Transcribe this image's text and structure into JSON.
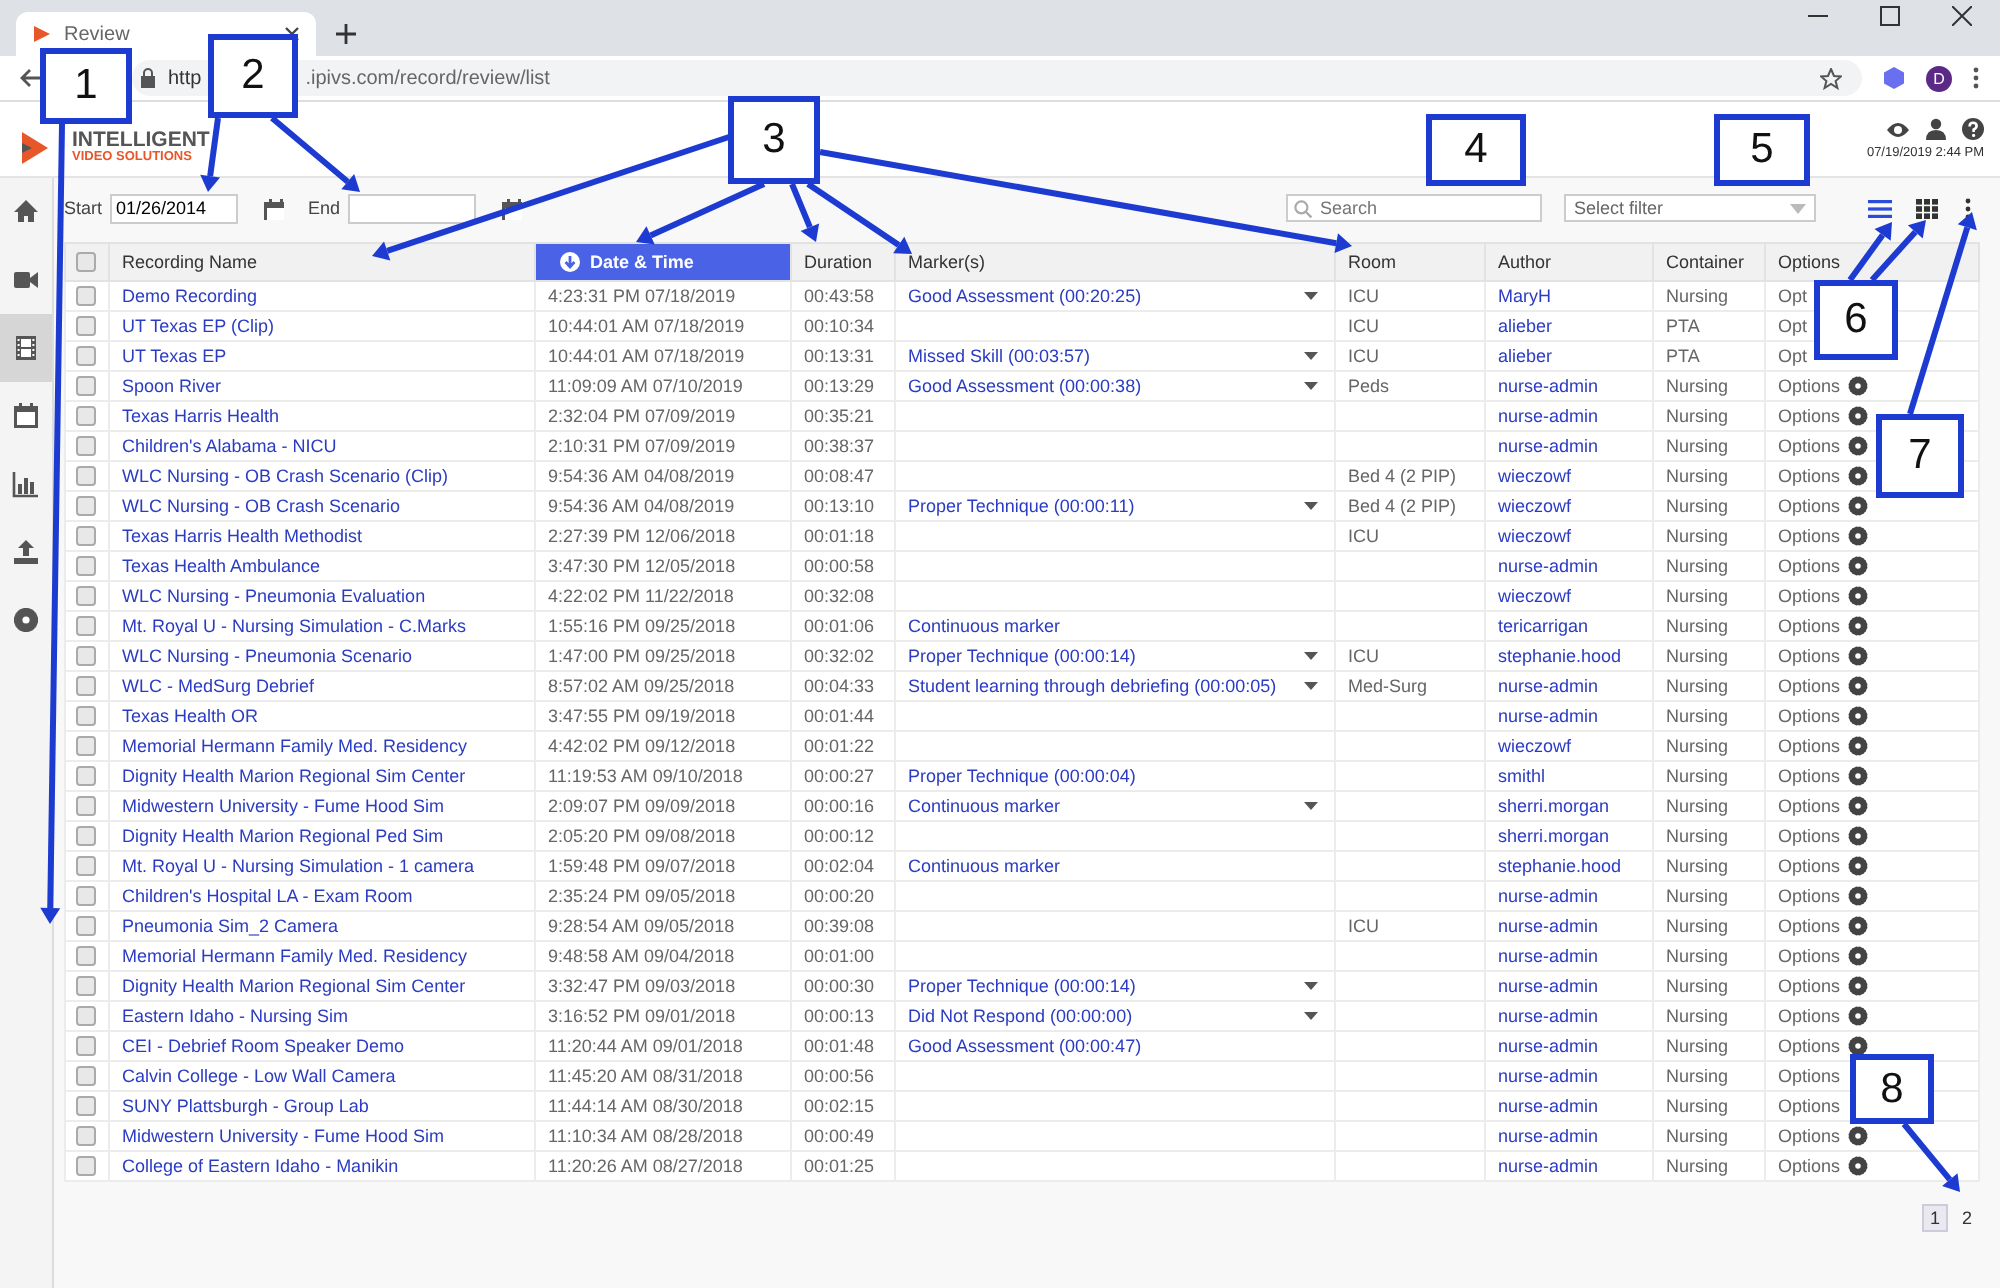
{
  "browser": {
    "tab_title": "Review",
    "url_parts": [
      "http",
      ".ipivs.com/record/review/list"
    ],
    "profile_initial": "D"
  },
  "app": {
    "logo_lines": [
      "INTELLIGENT",
      "VIDEO SOLUTIONS"
    ],
    "datetime": "07/19/2019 2:44 PM"
  },
  "sidebar": {
    "items": [
      {
        "kind": "home",
        "selected": false
      },
      {
        "kind": "camera",
        "selected": false
      },
      {
        "kind": "film",
        "selected": true
      },
      {
        "kind": "calendar",
        "selected": false
      },
      {
        "kind": "chart",
        "selected": false
      },
      {
        "kind": "upload",
        "selected": false
      },
      {
        "kind": "gear",
        "selected": false
      }
    ]
  },
  "filters": {
    "start_label": "Start",
    "start_value": "01/26/2014",
    "end_label": "End",
    "search_placeholder": "Search",
    "filter_placeholder": "Select filter"
  },
  "view_toggles": [
    {
      "kind": "list",
      "selected": true
    },
    {
      "kind": "grid",
      "selected": false
    },
    {
      "kind": "more",
      "selected": false
    }
  ],
  "table": {
    "select_all": {
      "checked": false
    },
    "columns": [
      {
        "label": "Recording Name",
        "sorted": false
      },
      {
        "label": "Date & Time",
        "sorted": true
      },
      {
        "label": "Duration",
        "sorted": false
      },
      {
        "label": "Marker(s)",
        "sorted": false
      },
      {
        "label": "Room",
        "sorted": false
      },
      {
        "label": "Author",
        "sorted": false
      },
      {
        "label": "Container",
        "sorted": false
      },
      {
        "label": "Options",
        "sorted": false
      }
    ],
    "rows": [
      {
        "checked": false,
        "name": "Demo Recording",
        "date": "4:23:31 PM 07/18/2019",
        "duration": "00:43:58",
        "marker": "Good Assessment (00:20:25)",
        "marker_menu": true,
        "room": "ICU",
        "author": "MaryH",
        "container": "Nursing",
        "options": "Opt",
        "gear": false
      },
      {
        "checked": false,
        "name": "UT Texas EP (Clip)",
        "date": "10:44:01 AM 07/18/2019",
        "duration": "00:10:34",
        "marker_menu": false,
        "room": "ICU",
        "author": "alieber",
        "container": "PTA",
        "options": "Opt",
        "gear": false
      },
      {
        "checked": false,
        "name": "UT Texas EP",
        "date": "10:44:01 AM 07/18/2019",
        "duration": "00:13:31",
        "marker": "Missed Skill (00:03:57)",
        "marker_menu": true,
        "room": "ICU",
        "author": "alieber",
        "container": "PTA",
        "options": "Opt",
        "gear": false
      },
      {
        "checked": false,
        "name": "Spoon River",
        "date": "11:09:09 AM 07/10/2019",
        "duration": "00:13:29",
        "marker": "Good Assessment (00:00:38)",
        "marker_menu": true,
        "room": "Peds",
        "author": "nurse-admin",
        "container": "Nursing",
        "options": "Options",
        "gear": true
      },
      {
        "checked": false,
        "name": "Texas Harris Health",
        "date": "2:32:04 PM 07/09/2019",
        "duration": "00:35:21",
        "marker_menu": false,
        "author": "nurse-admin",
        "container": "Nursing",
        "options": "Options",
        "gear": true
      },
      {
        "checked": false,
        "name": "Children's Alabama - NICU",
        "date": "2:10:31 PM 07/09/2019",
        "duration": "00:38:37",
        "marker_menu": false,
        "author": "nurse-admin",
        "container": "Nursing",
        "options": "Options",
        "gear": true
      },
      {
        "checked": false,
        "name": "WLC Nursing - OB Crash Scenario (Clip)",
        "date": "9:54:36 AM 04/08/2019",
        "duration": "00:08:47",
        "marker_menu": false,
        "room": "Bed 4 (2 PIP)",
        "author": "wieczowf",
        "container": "Nursing",
        "options": "Options",
        "gear": true
      },
      {
        "checked": false,
        "name": "WLC Nursing - OB Crash Scenario",
        "date": "9:54:36 AM 04/08/2019",
        "duration": "00:13:10",
        "marker": "Proper Technique (00:00:11)",
        "marker_menu": true,
        "room": "Bed 4 (2 PIP)",
        "author": "wieczowf",
        "container": "Nursing",
        "options": "Options",
        "gear": true
      },
      {
        "checked": false,
        "name": "Texas Harris Health Methodist",
        "date": "2:27:39 PM 12/06/2018",
        "duration": "00:01:18",
        "marker_menu": false,
        "room": "ICU",
        "author": "wieczowf",
        "container": "Nursing",
        "options": "Options",
        "gear": true
      },
      {
        "checked": false,
        "name": "Texas Health Ambulance",
        "date": "3:47:30 PM 12/05/2018",
        "duration": "00:00:58",
        "marker_menu": false,
        "author": "nurse-admin",
        "container": "Nursing",
        "options": "Options",
        "gear": true
      },
      {
        "checked": false,
        "name": "WLC Nursing - Pneumonia Evaluation",
        "date": "4:22:02 PM 11/22/2018",
        "duration": "00:32:08",
        "marker_menu": false,
        "author": "wieczowf",
        "container": "Nursing",
        "options": "Options",
        "gear": true
      },
      {
        "checked": false,
        "name": "Mt. Royal U - Nursing Simulation - C.Marks",
        "date": "1:55:16 PM 09/25/2018",
        "duration": "00:01:06",
        "marker": "Continuous marker",
        "marker_menu": false,
        "author": "tericarrigan",
        "container": "Nursing",
        "options": "Options",
        "gear": true
      },
      {
        "checked": false,
        "name": "WLC Nursing - Pneumonia Scenario",
        "date": "1:47:00 PM 09/25/2018",
        "duration": "00:32:02",
        "marker": "Proper Technique (00:00:14)",
        "marker_menu": true,
        "room": "ICU",
        "author": "stephanie.hood",
        "container": "Nursing",
        "options": "Options",
        "gear": true
      },
      {
        "checked": false,
        "name": "WLC - MedSurg Debrief",
        "date": "8:57:02 AM 09/25/2018",
        "duration": "00:04:33",
        "marker": "Student learning through debriefing (00:00:05)",
        "marker_menu": true,
        "room": "Med-Surg",
        "author": "nurse-admin",
        "container": "Nursing",
        "options": "Options",
        "gear": true
      },
      {
        "checked": false,
        "name": "Texas Health OR",
        "date": "3:47:55 PM 09/19/2018",
        "duration": "00:01:44",
        "marker_menu": false,
        "author": "nurse-admin",
        "container": "Nursing",
        "options": "Options",
        "gear": true
      },
      {
        "checked": false,
        "name": "Memorial Hermann Family Med. Residency",
        "date": "4:42:02 PM 09/12/2018",
        "duration": "00:01:22",
        "marker_menu": false,
        "author": "wieczowf",
        "container": "Nursing",
        "options": "Options",
        "gear": true
      },
      {
        "checked": false,
        "name": "Dignity Health Marion Regional Sim Center",
        "date": "11:19:53 AM 09/10/2018",
        "duration": "00:00:27",
        "marker": "Proper Technique (00:00:04)",
        "marker_menu": false,
        "author": "smithl",
        "container": "Nursing",
        "options": "Options",
        "gear": true
      },
      {
        "checked": false,
        "name": "Midwestern University - Fume Hood Sim",
        "date": "2:09:07 PM 09/09/2018",
        "duration": "00:00:16",
        "marker": "Continuous marker",
        "marker_menu": true,
        "author": "sherri.morgan",
        "container": "Nursing",
        "options": "Options",
        "gear": true
      },
      {
        "checked": false,
        "name": "Dignity Health Marion Regional Ped Sim",
        "date": "2:05:20 PM 09/08/2018",
        "duration": "00:00:12",
        "marker_menu": false,
        "author": "sherri.morgan",
        "container": "Nursing",
        "options": "Options",
        "gear": true
      },
      {
        "checked": false,
        "name": "Mt. Royal U - Nursing Simulation - 1 camera",
        "date": "1:59:48 PM 09/07/2018",
        "duration": "00:02:04",
        "marker": "Continuous marker",
        "marker_menu": false,
        "author": "stephanie.hood",
        "container": "Nursing",
        "options": "Options",
        "gear": true
      },
      {
        "checked": false,
        "name": "Children's Hospital LA - Exam Room",
        "date": "2:35:24 PM 09/05/2018",
        "duration": "00:00:20",
        "marker_menu": false,
        "author": "nurse-admin",
        "container": "Nursing",
        "options": "Options",
        "gear": true
      },
      {
        "checked": false,
        "name": "Pneumonia Sim_2 Camera",
        "date": "9:28:54 AM 09/05/2018",
        "duration": "00:39:08",
        "marker_menu": false,
        "room": "ICU",
        "author": "nurse-admin",
        "container": "Nursing",
        "options": "Options",
        "gear": true
      },
      {
        "checked": false,
        "name": "Memorial Hermann Family Med. Residency",
        "date": "9:48:58 AM 09/04/2018",
        "duration": "00:01:00",
        "marker_menu": false,
        "author": "nurse-admin",
        "container": "Nursing",
        "options": "Options",
        "gear": true
      },
      {
        "checked": false,
        "name": "Dignity Health Marion Regional Sim Center",
        "date": "3:32:47 PM 09/03/2018",
        "duration": "00:00:30",
        "marker": "Proper Technique (00:00:14)",
        "marker_menu": true,
        "author": "nurse-admin",
        "container": "Nursing",
        "options": "Options",
        "gear": true
      },
      {
        "checked": false,
        "name": "Eastern Idaho - Nursing Sim",
        "date": "3:16:52 PM 09/01/2018",
        "duration": "00:00:13",
        "marker": "Did Not Respond (00:00:00)",
        "marker_menu": true,
        "author": "nurse-admin",
        "container": "Nursing",
        "options": "Options",
        "gear": true
      },
      {
        "checked": false,
        "name": "CEI - Debrief Room Speaker Demo",
        "date": "11:20:44 AM 09/01/2018",
        "duration": "00:01:48",
        "marker": "Good Assessment (00:00:47)",
        "marker_menu": false,
        "author": "nurse-admin",
        "container": "Nursing",
        "options": "Options",
        "gear": true
      },
      {
        "checked": false,
        "name": "Calvin College - Low Wall Camera",
        "date": "11:45:20 AM 08/31/2018",
        "duration": "00:00:56",
        "marker_menu": false,
        "author": "nurse-admin",
        "container": "Nursing",
        "options": "Options",
        "gear": false
      },
      {
        "checked": false,
        "name": "SUNY Plattsburgh - Group Lab",
        "date": "11:44:14 AM 08/30/2018",
        "duration": "00:02:15",
        "marker_menu": false,
        "author": "nurse-admin",
        "container": "Nursing",
        "options": "Options",
        "gear": false
      },
      {
        "checked": false,
        "name": "Midwestern University - Fume Hood Sim",
        "date": "11:10:34 AM 08/28/2018",
        "duration": "00:00:49",
        "marker_menu": false,
        "author": "nurse-admin",
        "container": "Nursing",
        "options": "Options",
        "gear": true
      },
      {
        "checked": false,
        "name": "College of Eastern Idaho - Manikin",
        "date": "11:20:26 AM 08/27/2018",
        "duration": "00:01:25",
        "marker_menu": false,
        "author": "nurse-admin",
        "container": "Nursing",
        "options": "Options",
        "gear": true
      }
    ]
  },
  "pagination": [
    {
      "label": "1",
      "selected": true
    },
    {
      "label": "2",
      "selected": false
    }
  ],
  "callouts": [
    {
      "label": "1"
    },
    {
      "label": "2"
    },
    {
      "label": "3"
    },
    {
      "label": "4"
    },
    {
      "label": "5"
    },
    {
      "label": "6"
    },
    {
      "label": "7"
    },
    {
      "label": "8"
    }
  ]
}
